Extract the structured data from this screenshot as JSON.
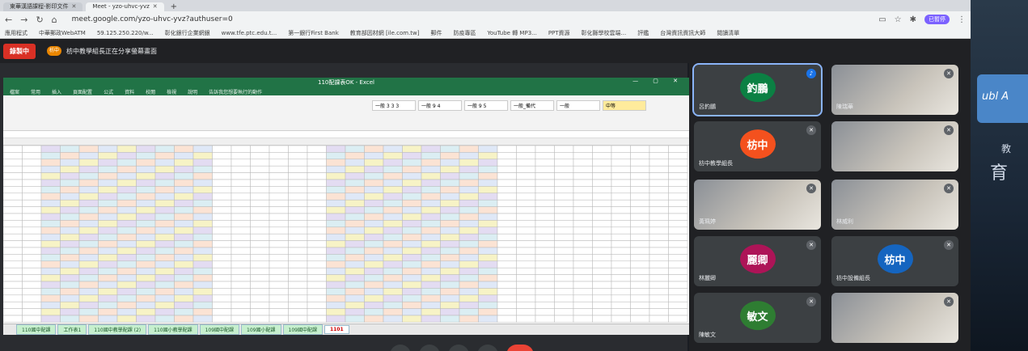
{
  "browser": {
    "tabs": [
      {
        "label": "東華漢語課程-影印文件",
        "active": false
      },
      {
        "label": "Meet - yzo-uhvc-yvz",
        "active": true
      }
    ],
    "url": "meet.google.com/yzo-uhvc-yvz?authuser=0",
    "profile_label": "已暫停",
    "bookmarks": [
      "應用程式",
      "中華郵政WebATM",
      "59.125.250.220/w...",
      "彰化銀行企業網銀",
      "www.tfe.ptc.edu.t...",
      "第一銀行First Bank",
      "教育部因材網 [ile.com.tw]",
      "郵件",
      "防疫專區",
      "YouTube 轉 MP3...",
      "PPT資源",
      "彰化縣學校雲端...",
      "評鑑",
      "台灣資訊資訊大師",
      "閱讀清單"
    ]
  },
  "meet": {
    "recording_label": "錄製中",
    "presenting_text": "枋中教學組長正在分享螢幕畫面",
    "presenter_badge": "枋中"
  },
  "excel": {
    "title": "110配課表OK - Excel",
    "menu": [
      "檔案",
      "常用",
      "插入",
      "頁面配置",
      "公式",
      "資料",
      "校閱",
      "檢視",
      "說明",
      "告訴我您想要執行的動作"
    ],
    "styles": [
      {
        "label": "一般 3 3 3",
        "kind": "normal"
      },
      {
        "label": "一般 9 4",
        "kind": "normal"
      },
      {
        "label": "一般 9 5",
        "kind": "normal"
      },
      {
        "label": "一般_備代",
        "kind": "normal"
      },
      {
        "label": "一般",
        "kind": "normal"
      },
      {
        "label": "中等",
        "kind": "neutral"
      }
    ],
    "sheets": [
      "110國中配課",
      "工作表1",
      "110國中教學配課 (2)",
      "110國小教學配課",
      "109國中配課",
      "109國小配課",
      "109國中配課",
      "1101"
    ],
    "active_sheet": "1101"
  },
  "participants": [
    {
      "name": "呂釣鵬",
      "avatar_text": "釣鵬",
      "avatar_color": "#0b8043",
      "mic": "on",
      "active": true
    },
    {
      "name": "陳瑞華",
      "avatar_text": "",
      "avatar_color": "#5f6368",
      "mic": "off",
      "photo": true
    },
    {
      "name": "枋中教學組長",
      "avatar_text": "枋中",
      "avatar_color": "#f4511e",
      "mic": "off"
    },
    {
      "name": "",
      "avatar_text": "",
      "avatar_color": "#5f6368",
      "mic": "off",
      "photo": true
    },
    {
      "name": "黃珮婷",
      "avatar_text": "",
      "avatar_color": "#5f6368",
      "mic": "off",
      "photo": true
    },
    {
      "name": "林威利",
      "avatar_text": "",
      "avatar_color": "#5f6368",
      "mic": "off",
      "photo": true
    },
    {
      "name": "林麗卿",
      "avatar_text": "麗卿",
      "avatar_color": "#ad1457",
      "mic": "off"
    },
    {
      "name": "枋中設備組長",
      "avatar_text": "枋中",
      "avatar_color": "#1565c0",
      "mic": "off"
    },
    {
      "name": "陳敏文",
      "avatar_text": "敏文",
      "avatar_color": "#2e7d32",
      "mic": "off"
    },
    {
      "name": "",
      "avatar_text": "",
      "avatar_color": "#5f6368",
      "mic": "off",
      "photo": true
    }
  ],
  "background_sign": {
    "text": "ubl A",
    "char1": "教",
    "char2": "育"
  },
  "colors": {
    "excel_green": "#217346",
    "meet_bg": "#202124",
    "recording": "#d93025",
    "presenting": "#ea8600"
  }
}
